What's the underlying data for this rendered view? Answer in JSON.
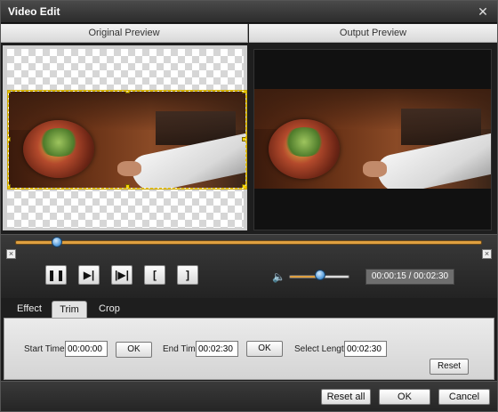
{
  "window": {
    "title": "Video Edit",
    "close_glyph": "✕"
  },
  "preview": {
    "original_label": "Original Preview",
    "output_label": "Output Preview"
  },
  "timeline": {
    "position_fraction": 0.09,
    "left_marker_glyph": "×",
    "right_marker_glyph": "×"
  },
  "controls": {
    "pause_glyph": "❚❚",
    "play_glyph": "▶|",
    "next_frame_glyph": "|▶|",
    "trim_start_glyph": "[",
    "trim_end_glyph": "]",
    "volume_icon_glyph": "🔈",
    "volume_fraction": 0.52,
    "time_display": "00:00:15 / 00:02:30"
  },
  "tabs": [
    {
      "label": "Effect",
      "active": false
    },
    {
      "label": "Trim",
      "active": true
    },
    {
      "label": "Crop",
      "active": false
    }
  ],
  "trim": {
    "start_label": "Start Time",
    "start_value": "00:00:00",
    "start_ok": "OK",
    "end_label": "End Time",
    "end_value": "00:02:30",
    "end_ok": "OK",
    "length_label": "Select Length",
    "length_value": "00:02:30",
    "reset": "Reset"
  },
  "footer": {
    "reset_all": "Reset all",
    "ok": "OK",
    "cancel": "Cancel"
  },
  "colors": {
    "accent_orange": "#e0a040",
    "knob_blue": "#5a9fdc",
    "crop_border": "#e6c000"
  }
}
